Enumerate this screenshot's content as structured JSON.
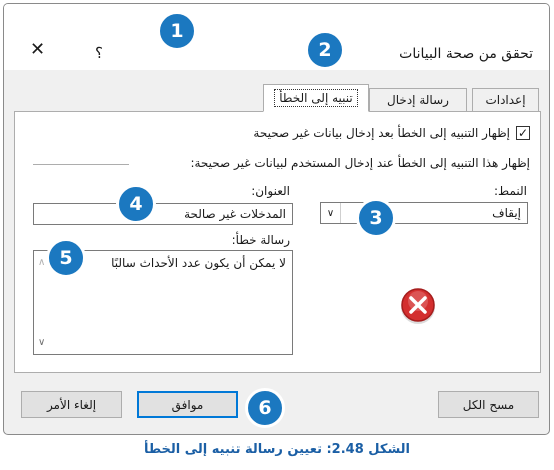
{
  "dialog": {
    "title": "تحقق من صحة البيانات",
    "help_glyph": "؟",
    "close_glyph": "✕"
  },
  "tabs": [
    {
      "label": "إعدادات"
    },
    {
      "label": "رسالة إدخال"
    },
    {
      "label": "تنبيه إلى الخطأ",
      "active": true
    }
  ],
  "error_alert": {
    "show_checkbox_label": "إظهار التنبيه إلى الخطأ بعد إدخال بيانات غير صحيحة",
    "show_checkbox_checked": true,
    "section_label": "إظهار هذا التنبيه إلى الخطأ عند إدخال المستخدم لبيانات غير صحيحة:",
    "style_label": "النمط:",
    "style_value": "إيقاف",
    "title_label": "العنوان:",
    "title_value": "المدخلات غير صالحة",
    "message_label": "رسالة خطأ:",
    "message_value": "لا يمكن أن يكون عدد الأحداث سالبًا",
    "style_icon": "stop-error-icon"
  },
  "buttons": {
    "clear_all": "مسح الكل",
    "ok": "موافق",
    "cancel": "إلغاء الأمر"
  },
  "callouts": [
    "1",
    "2",
    "3",
    "4",
    "5",
    "6"
  ],
  "caption": "الشكل 2.48: تعيين رسالة تنبيه إلى الخطأ",
  "colors": {
    "callout": "#1b78c0",
    "caption": "#1b5fa5",
    "ok_border": "#0078d7",
    "stop_icon": "#d32f2f"
  }
}
